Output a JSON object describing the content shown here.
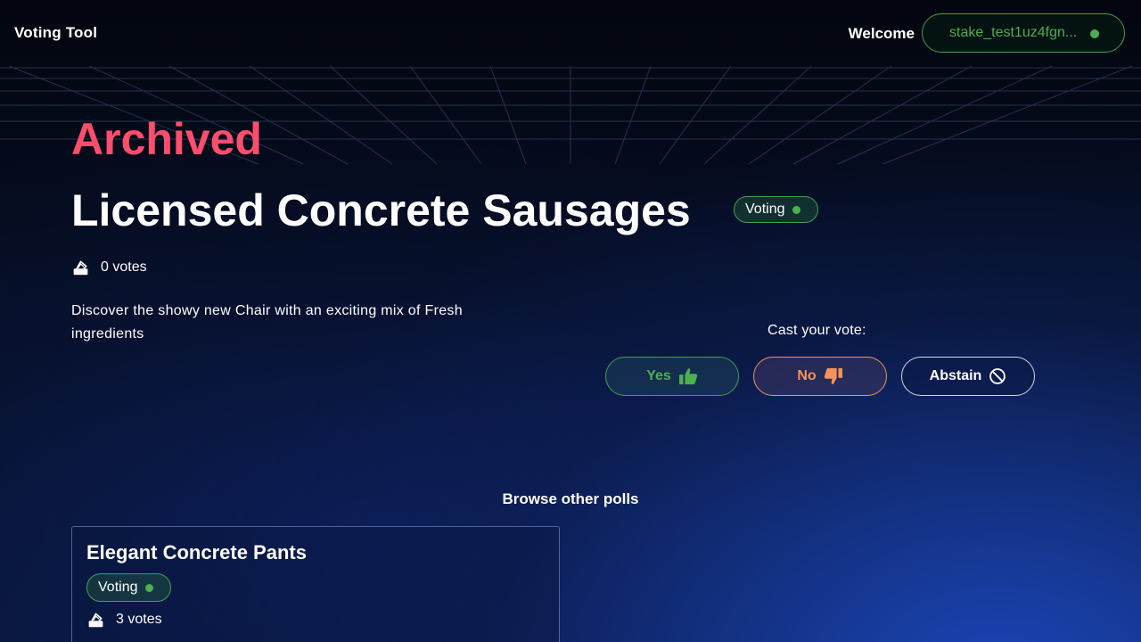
{
  "header": {
    "app_title": "Voting Tool",
    "welcome": "Welcome",
    "wallet_address": "stake_test1uz4fgn..."
  },
  "poll": {
    "status_heading": "Archived",
    "title": "Licensed Concrete Sausages",
    "badge": "Voting",
    "votes": "0 votes",
    "description": "Discover the showy new Chair with an exciting mix of Fresh ingredients"
  },
  "vote": {
    "prompt": "Cast your vote:",
    "yes_label": "Yes",
    "no_label": "No",
    "abstain_label": "Abstain"
  },
  "browse": {
    "heading": "Browse other polls",
    "polls": [
      {
        "title": "Elegant Concrete Pants",
        "badge": "Voting",
        "votes": "3 votes"
      }
    ]
  },
  "colors": {
    "archived": "#ff4d6d",
    "accent_green": "#4caf50",
    "no_orange": "#f0945a"
  },
  "icons": {
    "wallet_status": "green-dot-icon",
    "votes": "ballot-box-icon",
    "yes": "thumbs-up-icon",
    "no": "thumbs-down-icon",
    "abstain": "prohibited-icon"
  }
}
